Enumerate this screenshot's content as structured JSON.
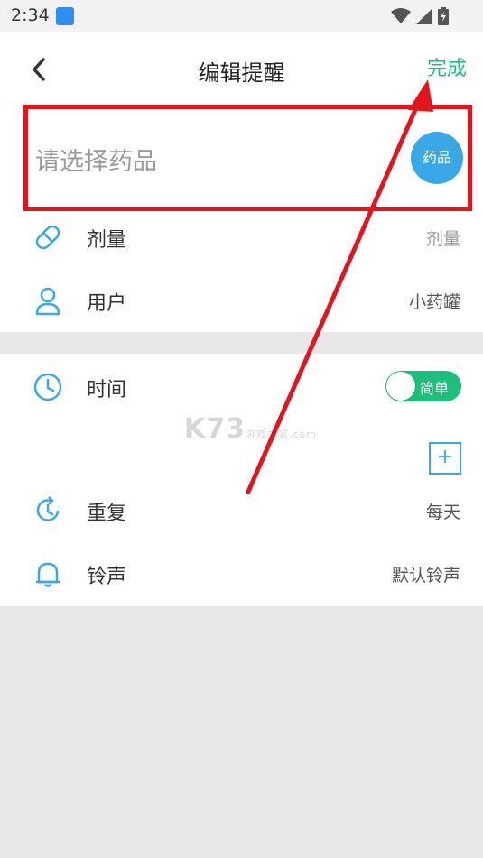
{
  "status_bar": {
    "time": "2:34"
  },
  "header": {
    "title": "编辑提醒",
    "done_label": "完成"
  },
  "medicine": {
    "placeholder": "请选择药品",
    "badge": "药品"
  },
  "rows": {
    "dosage": {
      "label": "剂量",
      "value": "剂量",
      "icon": "pill-icon"
    },
    "user": {
      "label": "用户",
      "value": "小药罐",
      "icon": "user-icon"
    },
    "time": {
      "label": "时间",
      "toggle_label": "简单",
      "icon": "clock-icon"
    },
    "add": {
      "label": "+"
    },
    "repeat": {
      "label": "重复",
      "value": "每天",
      "icon": "repeat-icon"
    },
    "ringtone": {
      "label": "铃声",
      "value": "默认铃声",
      "icon": "bell-icon"
    }
  },
  "watermark": {
    "main": "K73",
    "sub": "游戏之家",
    "dotcom": ".com"
  },
  "colors": {
    "accent_green": "#1cc07a",
    "accent_blue": "#3aa7e6",
    "highlight_red": "#e3141b"
  }
}
